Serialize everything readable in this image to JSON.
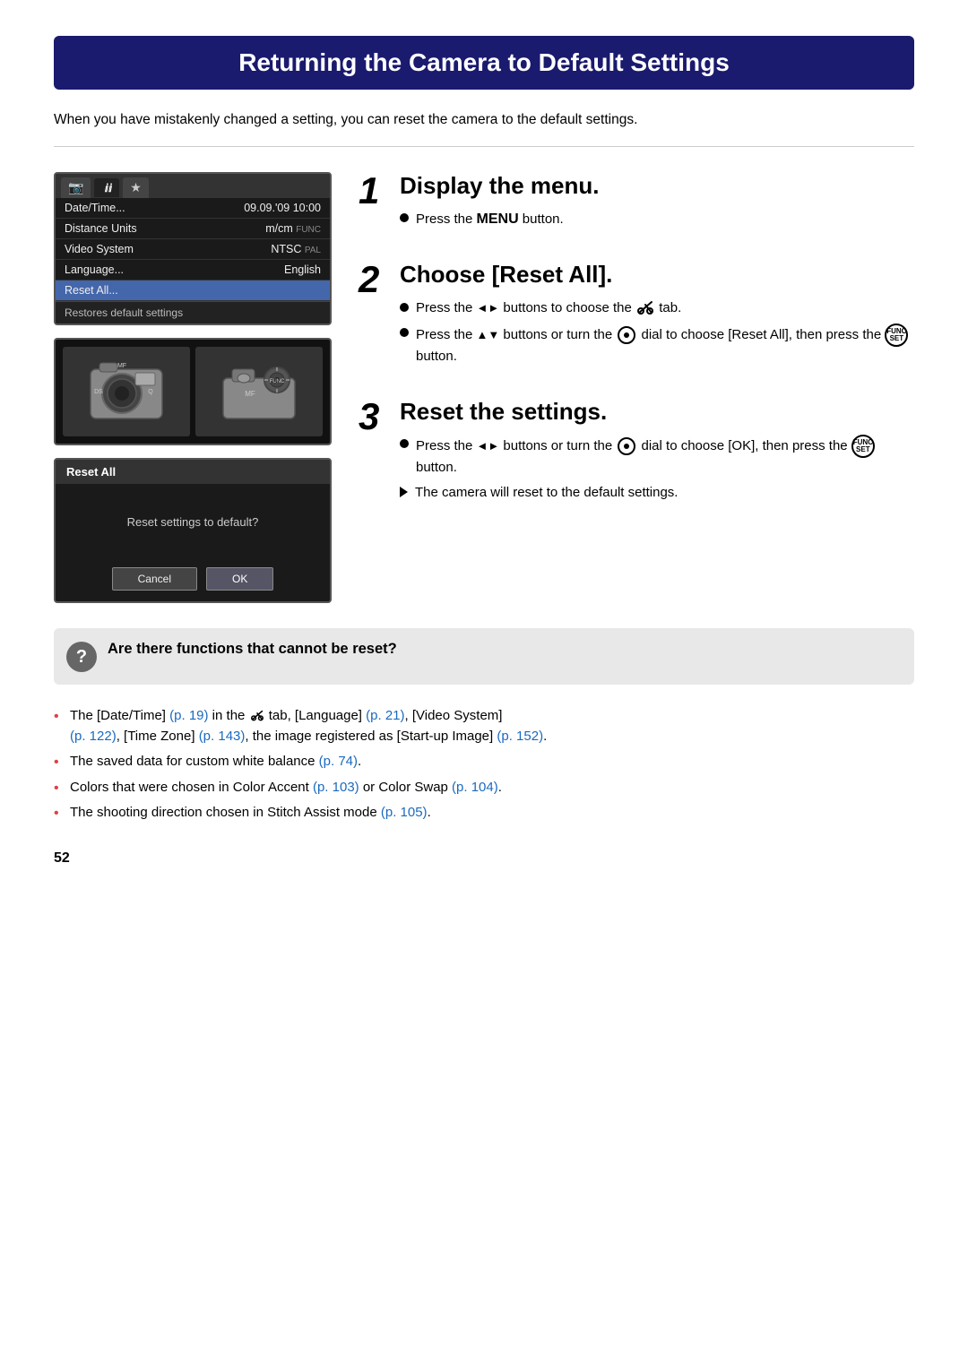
{
  "page": {
    "title": "Returning the Camera to Default Settings",
    "page_number": "52"
  },
  "intro": {
    "text": "When you have mistakenly changed a setting, you can reset the camera to the default settings."
  },
  "menu_screenshot": {
    "tabs": [
      "camera",
      "tools",
      "star"
    ],
    "active_tab": "tools",
    "rows": [
      {
        "label": "Date/Time...",
        "value": "09.09.'09 10:00",
        "highlighted": false
      },
      {
        "label": "Distance Units",
        "value": "m/cm",
        "extra": "FUNC",
        "highlighted": false
      },
      {
        "label": "Video System",
        "value": "NTSC",
        "extra": "PAL",
        "highlighted": false
      },
      {
        "label": "Language...",
        "value": "English",
        "highlighted": false
      },
      {
        "label": "Reset All...",
        "value": "",
        "highlighted": true
      }
    ],
    "tooltip": "Restores default settings"
  },
  "reset_dialog": {
    "title": "Reset All",
    "body": "Reset settings to default?",
    "cancel_label": "Cancel",
    "ok_label": "OK"
  },
  "steps": [
    {
      "number": "1",
      "heading": "Display the menu.",
      "bullets": [
        {
          "type": "dot",
          "text": "Press the MENU button.",
          "has_menu": true
        }
      ]
    },
    {
      "number": "2",
      "heading": "Choose [Reset All].",
      "bullets": [
        {
          "type": "dot",
          "text": "Press the ◄► buttons to choose the 🔧🔧 tab."
        },
        {
          "type": "dot",
          "text": "Press the ▲▼ buttons or turn the dial to choose [Reset All], then press the FUNC button."
        }
      ]
    },
    {
      "number": "3",
      "heading": "Reset the settings.",
      "bullets": [
        {
          "type": "dot",
          "text": "Press the ◄► buttons or turn the dial to choose [OK], then press the FUNC button."
        },
        {
          "type": "arrow",
          "text": "The camera will reset to the default settings."
        }
      ]
    }
  ],
  "faq": {
    "heading": "Are there functions that cannot be reset?",
    "items": [
      {
        "text_parts": [
          {
            "text": "The [Date/Time] ",
            "type": "normal"
          },
          {
            "text": "(p. 19)",
            "type": "link"
          },
          {
            "text": " in the 🔧🔧 tab, [Language] ",
            "type": "normal"
          },
          {
            "text": "(p. 21)",
            "type": "link"
          },
          {
            "text": ", [Video System]",
            "type": "normal"
          }
        ],
        "line2_parts": [
          {
            "text": "(p. 122)",
            "type": "link"
          },
          {
            "text": ", [Time Zone] ",
            "type": "normal"
          },
          {
            "text": "(p. 143)",
            "type": "link"
          },
          {
            "text": ", the image registered as [Start-up Image] ",
            "type": "normal"
          },
          {
            "text": "(p. 152)",
            "type": "link"
          },
          {
            "text": ".",
            "type": "normal"
          }
        ]
      },
      {
        "text": "The saved data for custom white balance ",
        "link": "(p. 74)",
        "after": "."
      },
      {
        "text": "Colors that were chosen in Color Accent ",
        "link": "(p. 103)",
        "mid": " or Color Swap ",
        "link2": "(p. 104)",
        "after": "."
      },
      {
        "text": "The shooting direction chosen in Stitch Assist mode ",
        "link": "(p. 105)",
        "after": "."
      }
    ]
  }
}
